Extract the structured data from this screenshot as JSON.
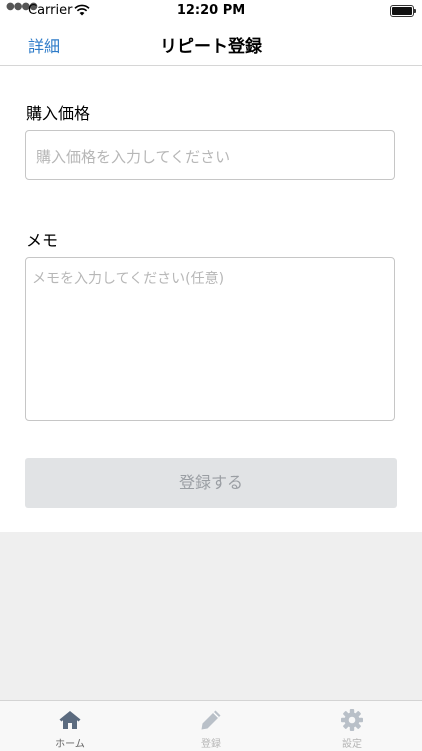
{
  "status_bar": {
    "carrier": "Carrier",
    "time": "12:20 PM"
  },
  "nav": {
    "back_label": "詳細",
    "title": "リピート登録"
  },
  "form": {
    "price_label": "購入価格",
    "price_placeholder": "購入価格を入力してください",
    "memo_label": "メモ",
    "memo_placeholder": "メモを入力してください(任意)",
    "submit_label": "登録する"
  },
  "tabs": [
    {
      "label": "ホーム",
      "icon": "home-icon",
      "color": "#5b6b7f"
    },
    {
      "label": "登録",
      "icon": "pencil-icon",
      "color": "#b9c0c8"
    },
    {
      "label": "設定",
      "icon": "gear-icon",
      "color": "#b9c0c8"
    }
  ],
  "colors": {
    "accent": "#2f7cc9",
    "disabled_button": "#e1e3e5"
  }
}
